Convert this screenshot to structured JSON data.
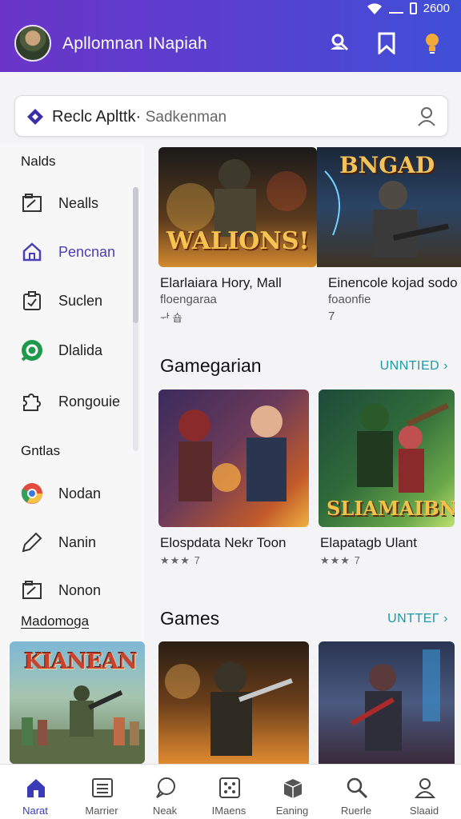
{
  "status_bar": {
    "time": "2600"
  },
  "header": {
    "title": "Apllomnan INapiah",
    "icons": [
      "user-search-icon",
      "bookmark-icon",
      "lightbulb-icon"
    ]
  },
  "search": {
    "query": "Reclc Aplttk",
    "separator": "·",
    "placeholder": "Sadkenman"
  },
  "sidebar": {
    "section1": "Nalds",
    "items1": [
      {
        "label": "Nealls",
        "icon": "folder-icon"
      },
      {
        "label": "Pencnan",
        "icon": "home-icon",
        "active": true
      },
      {
        "label": "Suclen",
        "icon": "clipboard-icon"
      },
      {
        "label": "Dlalida",
        "icon": "chat-icon"
      },
      {
        "label": "Rongouie",
        "icon": "puzzle-icon"
      }
    ],
    "section2": "Gntlas",
    "items2": [
      {
        "label": "Nodan",
        "icon": "chrome-icon"
      },
      {
        "label": "Nanin",
        "icon": "pencil-icon"
      },
      {
        "label": "Nonon",
        "icon": "folder-icon"
      }
    ],
    "section3": "Madomoga",
    "promo_title": "KIANEAN"
  },
  "featured": [
    {
      "banner": "WALIONS!",
      "title": "Elarlaiara Hory, Mall",
      "sub": "floengaraa",
      "meta": "ᆉ 숍"
    },
    {
      "banner": "BNGAD",
      "title": "Einencole kojad sodo",
      "sub": "foaonfie",
      "meta": "7"
    }
  ],
  "section_gamegarian": {
    "title": "Gamegarian",
    "link": "UNNTIED ›",
    "cards": [
      {
        "title": "Elospdata Nekr Toon",
        "rating": "★★★ 7"
      },
      {
        "banner": "SLIAMAIBN",
        "title": "Elapatagb Ulant",
        "rating": "★★★ 7"
      }
    ]
  },
  "section_games": {
    "title": "Games",
    "link": "UNTTEΓ ›"
  },
  "bottom_nav": [
    {
      "label": "Narat",
      "icon": "home-icon",
      "active": true
    },
    {
      "label": "Marrier",
      "icon": "list-icon"
    },
    {
      "label": "Neak",
      "icon": "chat-bubble-icon"
    },
    {
      "label": "IMaens",
      "icon": "dice-icon"
    },
    {
      "label": "Eaning",
      "icon": "box-icon"
    },
    {
      "label": "Ruerle",
      "icon": "search-icon"
    },
    {
      "label": "Slaaid",
      "icon": "profile-icon"
    }
  ],
  "colors": {
    "header_start": "#6a35c8",
    "header_end": "#3f4fd6",
    "accent": "#4a3fb5",
    "link": "#1a9aa8"
  }
}
